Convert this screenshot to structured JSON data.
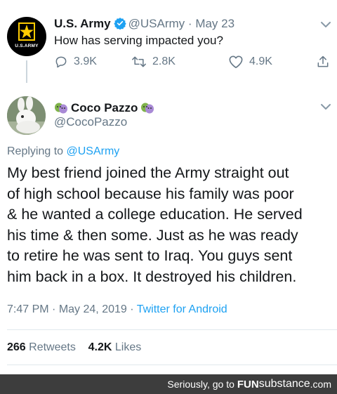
{
  "parent_tweet": {
    "avatar_text": "U.S.ARMY",
    "display_name": "U.S. Army",
    "handle": "@USArmy",
    "date": "May 23",
    "separator": "·",
    "text": "How has serving impacted you?",
    "actions": {
      "replies": "3.9K",
      "retweets": "2.8K",
      "likes": "4.9K"
    }
  },
  "reply_tweet": {
    "display_name": "Coco Pazzo",
    "handle": "@CocoPazzo",
    "replying_to_label": "Replying to",
    "replying_to_handle": "@USArmy",
    "lines": [
      "My best friend joined the Army straight out",
      "of high school because his family was poor",
      "& he wanted a college education. He served",
      "his time & then some. Just as he was ready",
      "to retire he was sent to Iraq. You guys sent",
      "him back in a box. It destroyed his children."
    ],
    "time": "7:47 PM",
    "date": "May 24, 2019",
    "separator": "·",
    "client": "Twitter for Android",
    "retweets_count": "266",
    "retweets_label": "Retweets",
    "likes_count": "4.2K",
    "likes_label": "Likes"
  },
  "footer": {
    "prefix": "Seriously, go to",
    "brand_fun": "FUN",
    "brand_sub": "substance",
    "brand_com": ".com"
  },
  "colors": {
    "link_blue": "#1da1f2",
    "muted_gray": "#657786",
    "text_dark": "#14171a",
    "footer_bg": "#3d3d3d",
    "army_gold": "#ffcc01"
  },
  "icons": [
    "verified-badge-icon",
    "chevron-down-icon",
    "reply-icon",
    "retweet-icon",
    "like-icon",
    "share-icon",
    "theater-masks-icon",
    "army-star-logo"
  ]
}
